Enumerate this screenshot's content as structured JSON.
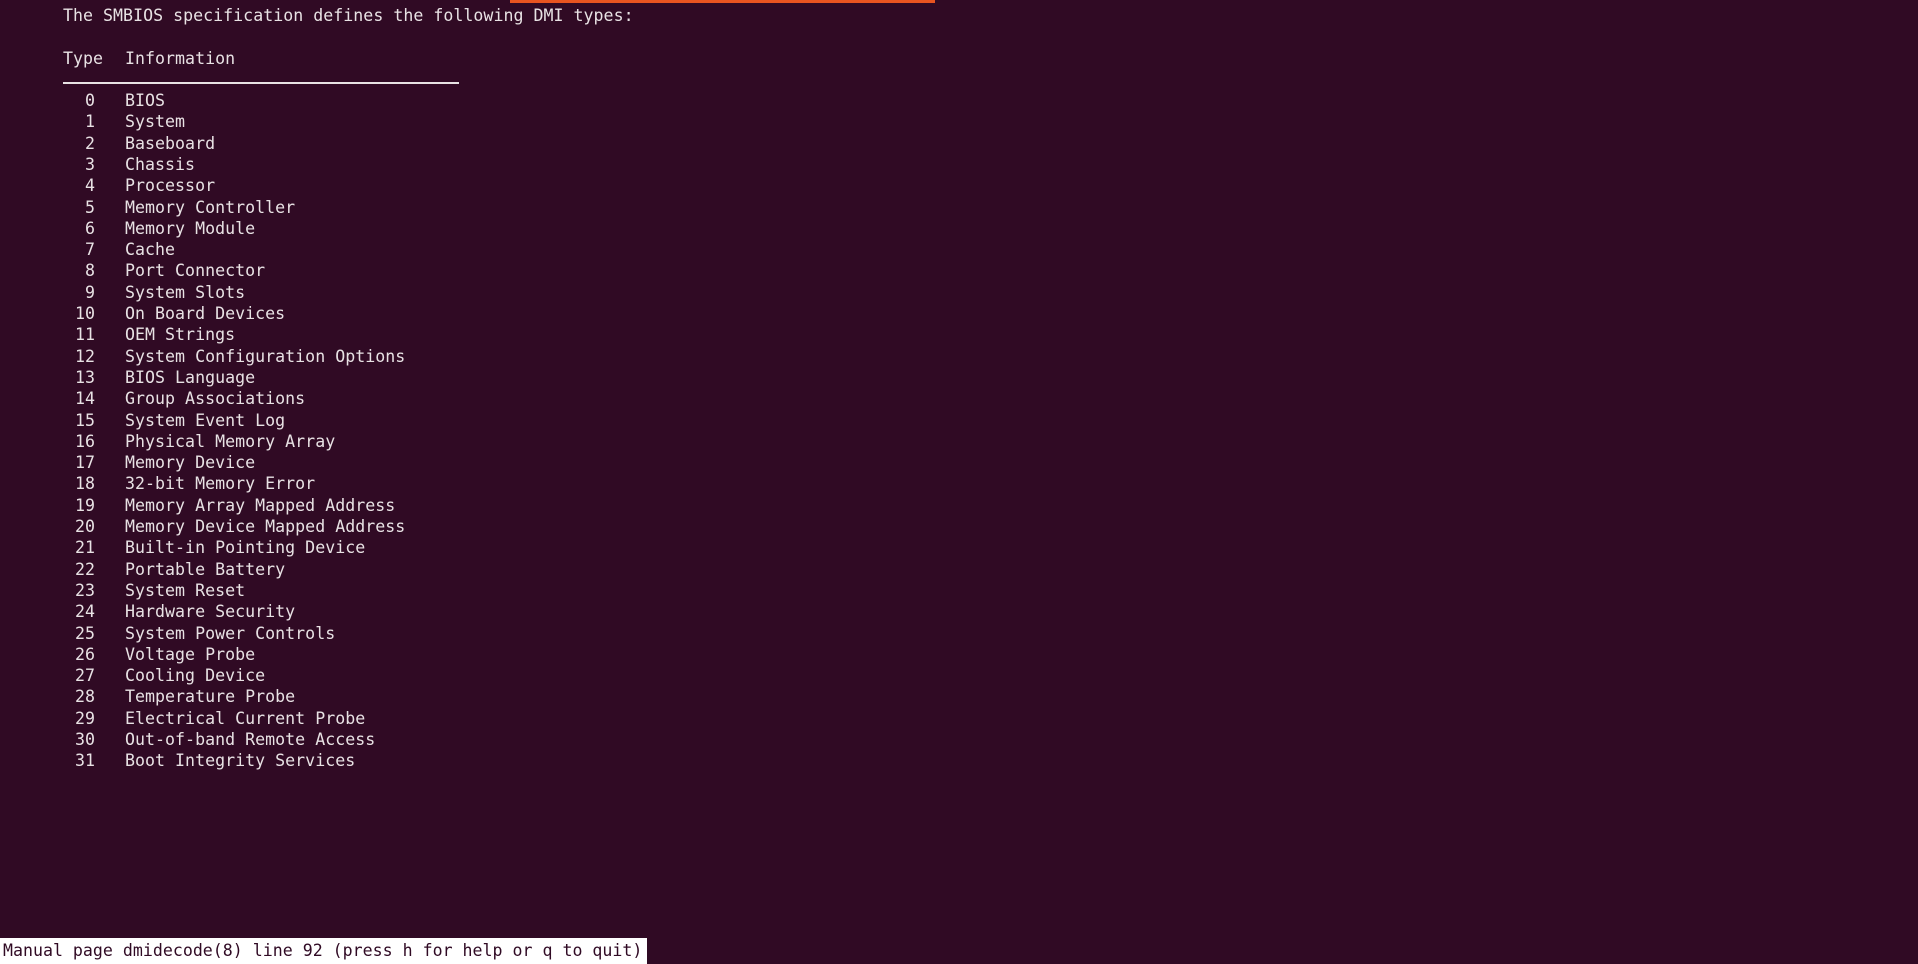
{
  "terminal": {
    "background_color": "#300a24",
    "foreground_color": "#e8e2e4",
    "accent_color": "#e95420"
  },
  "pager": {
    "intro_text": "The SMBIOS specification defines the following DMI types:",
    "columns": {
      "type_header": "Type",
      "information_header": "Information"
    },
    "rows": [
      {
        "type": "0",
        "information": "BIOS"
      },
      {
        "type": "1",
        "information": "System"
      },
      {
        "type": "2",
        "information": "Baseboard"
      },
      {
        "type": "3",
        "information": "Chassis"
      },
      {
        "type": "4",
        "information": "Processor"
      },
      {
        "type": "5",
        "information": "Memory Controller"
      },
      {
        "type": "6",
        "information": "Memory Module"
      },
      {
        "type": "7",
        "information": "Cache"
      },
      {
        "type": "8",
        "information": "Port Connector"
      },
      {
        "type": "9",
        "information": "System Slots"
      },
      {
        "type": "10",
        "information": "On Board Devices"
      },
      {
        "type": "11",
        "information": "OEM Strings"
      },
      {
        "type": "12",
        "information": "System Configuration Options"
      },
      {
        "type": "13",
        "information": "BIOS Language"
      },
      {
        "type": "14",
        "information": "Group Associations"
      },
      {
        "type": "15",
        "information": "System Event Log"
      },
      {
        "type": "16",
        "information": "Physical Memory Array"
      },
      {
        "type": "17",
        "information": "Memory Device"
      },
      {
        "type": "18",
        "information": "32-bit Memory Error"
      },
      {
        "type": "19",
        "information": "Memory Array Mapped Address"
      },
      {
        "type": "20",
        "information": "Memory Device Mapped Address"
      },
      {
        "type": "21",
        "information": "Built-in Pointing Device"
      },
      {
        "type": "22",
        "information": "Portable Battery"
      },
      {
        "type": "23",
        "information": "System Reset"
      },
      {
        "type": "24",
        "information": "Hardware Security"
      },
      {
        "type": "25",
        "information": "System Power Controls"
      },
      {
        "type": "26",
        "information": "Voltage Probe"
      },
      {
        "type": "27",
        "information": "Cooling Device"
      },
      {
        "type": "28",
        "information": "Temperature Probe"
      },
      {
        "type": "29",
        "information": "Electrical Current Probe"
      },
      {
        "type": "30",
        "information": "Out-of-band Remote Access"
      },
      {
        "type": "31",
        "information": "Boot Integrity Services"
      }
    ]
  },
  "status_bar": {
    "text": "Manual page dmidecode(8) line 92 (press h for help or q to quit)",
    "manual_name": "dmidecode(8)",
    "line_number": "92",
    "background_color": "#ffffff",
    "text_color": "#300a24"
  }
}
